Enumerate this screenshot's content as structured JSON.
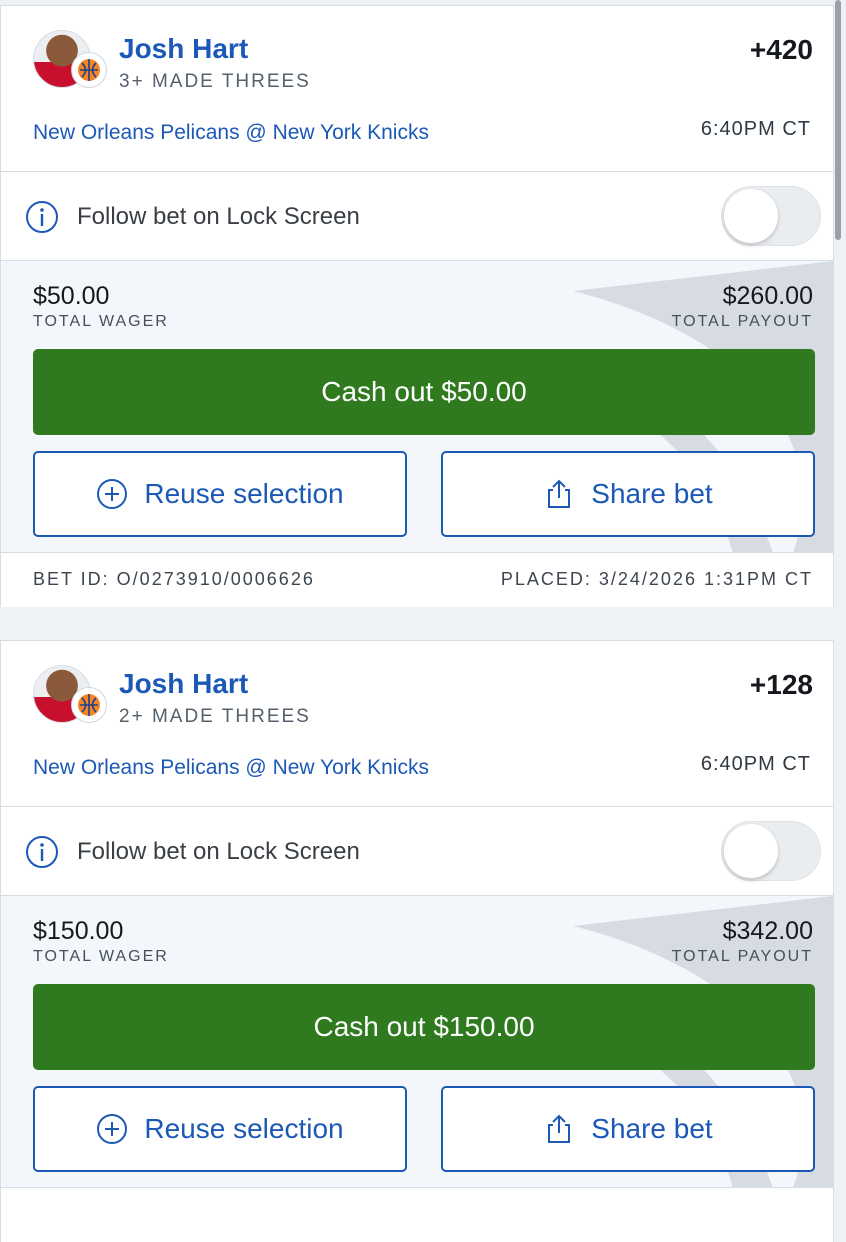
{
  "bets": [
    {
      "player": "Josh Hart",
      "market": "3+ MADE THREES",
      "odds": "+420",
      "matchup": "New Orleans Pelicans @ New York Knicks",
      "game_time": "6:40PM CT",
      "follow_label": "Follow bet on Lock Screen",
      "follow_enabled": false,
      "wager_amount": "$50.00",
      "wager_label": "TOTAL WAGER",
      "payout_amount": "$260.00",
      "payout_label": "TOTAL PAYOUT",
      "cashout_label": "Cash out $50.00",
      "reuse_label": "Reuse selection",
      "share_label": "Share bet",
      "bet_id": "BET ID: O/0273910/0006626",
      "placed": "PLACED: 3/24/2026 1:31PM CT"
    },
    {
      "player": "Josh Hart",
      "market": "2+ MADE THREES",
      "odds": "+128",
      "matchup": "New Orleans Pelicans @ New York Knicks",
      "game_time": "6:40PM CT",
      "follow_label": "Follow bet on Lock Screen",
      "follow_enabled": false,
      "wager_amount": "$150.00",
      "wager_label": "TOTAL WAGER",
      "payout_amount": "$342.00",
      "payout_label": "TOTAL PAYOUT",
      "cashout_label": "Cash out $150.00",
      "reuse_label": "Reuse selection",
      "share_label": "Share bet"
    }
  ],
  "colors": {
    "link_blue": "#1c59b7",
    "cashout_green": "#2f7a1e",
    "section_bg": "#f3f7fb"
  },
  "icons": {
    "info": "info-icon",
    "reuse": "plus-circle-icon",
    "share": "share-icon",
    "team": "knicks-logo-icon"
  }
}
